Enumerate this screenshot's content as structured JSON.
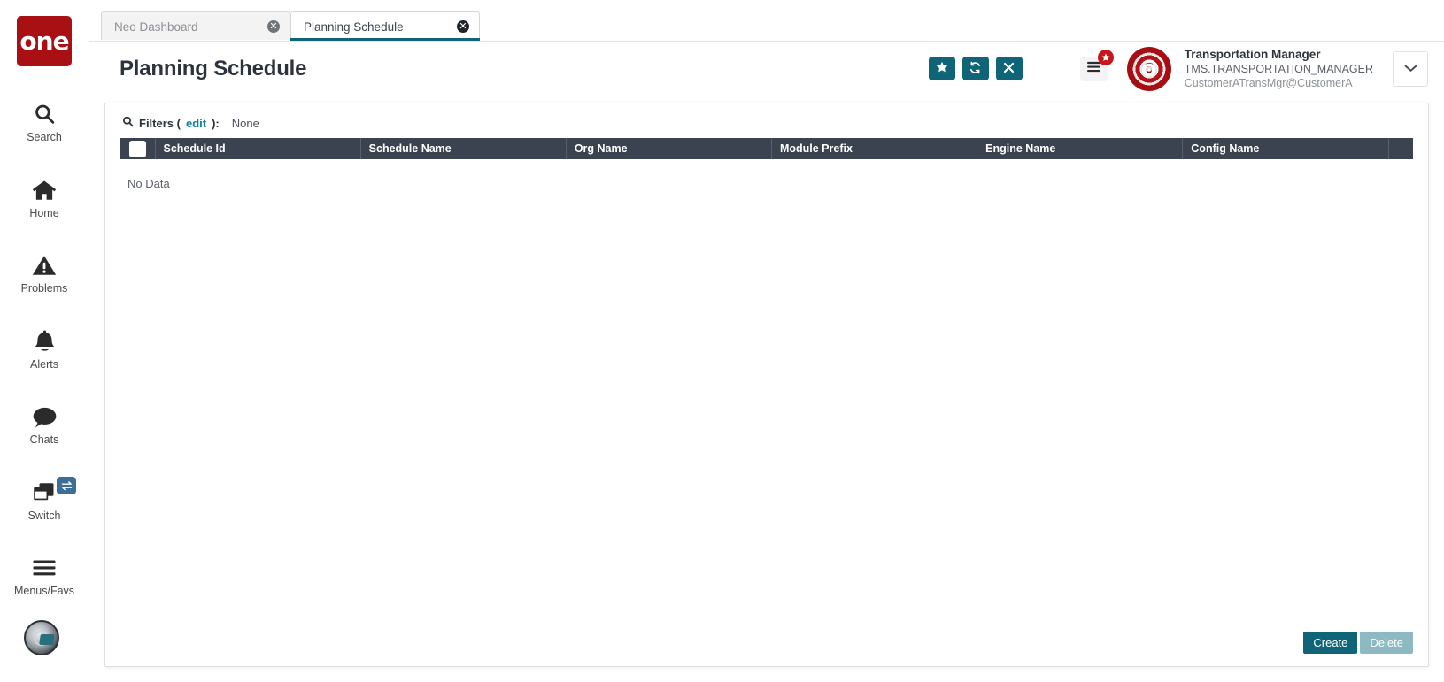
{
  "brand": {
    "logo_text": "one",
    "logo_color": "#a91013"
  },
  "sidebar": {
    "items": [
      {
        "label": "Search",
        "icon": "search-icon"
      },
      {
        "label": "Home",
        "icon": "home-icon"
      },
      {
        "label": "Problems",
        "icon": "warning-triangle-icon"
      },
      {
        "label": "Alerts",
        "icon": "bell-icon"
      },
      {
        "label": "Chats",
        "icon": "chat-bubble-icon"
      },
      {
        "label": "Switch",
        "icon": "windows-stack-icon",
        "badge_icon": "swap-arrows-icon"
      },
      {
        "label": "Menus/Favs",
        "icon": "hamburger-icon"
      }
    ],
    "bottom_avatar_icon": "user-avatar-icon"
  },
  "tabs": [
    {
      "label": "Neo Dashboard",
      "active": false,
      "close_icon": "close-circle-icon"
    },
    {
      "label": "Planning Schedule",
      "active": true,
      "close_icon": "close-circle-icon"
    }
  ],
  "header": {
    "title": "Planning Schedule",
    "actions": [
      {
        "name": "favorite-button",
        "icon": "star-icon"
      },
      {
        "name": "refresh-button",
        "icon": "refresh-icon"
      },
      {
        "name": "close-button",
        "icon": "x-icon"
      }
    ],
    "menu_button": {
      "icon": "hamburger-icon",
      "badge_icon": "star-icon"
    },
    "user": {
      "name": "Transportation Manager",
      "id": "TMS.TRANSPORTATION_MANAGER",
      "email": "CustomerATransMgr@CustomerA",
      "avatar_text": "o"
    },
    "caret_icon": "chevron-down-icon",
    "accent_color": "#0f6477"
  },
  "filters": {
    "icon": "search-icon",
    "label": "Filters (",
    "edit_link": "edit",
    "label_end": "):",
    "value": "None"
  },
  "table": {
    "select_all_checkbox": "",
    "columns": [
      "Schedule Id",
      "Schedule Name",
      "Org Name",
      "Module Prefix",
      "Engine Name",
      "Config Name"
    ],
    "rows": [],
    "empty_message": "No Data"
  },
  "footer": {
    "create_label": "Create",
    "delete_label": "Delete"
  }
}
